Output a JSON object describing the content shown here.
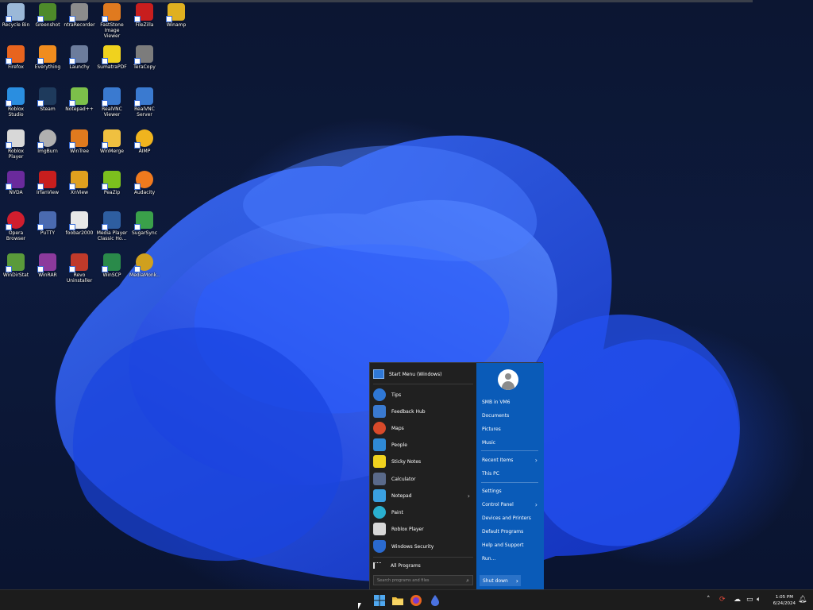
{
  "desktop": {
    "icons": [
      {
        "label": "Recycle Bin",
        "icon": "recycle-bin-icon",
        "color": "#9bb8d8"
      },
      {
        "label": "Greenshot",
        "icon": "greenshot-icon",
        "color": "#4e8a2a"
      },
      {
        "label": "ntraRecorder",
        "icon": "recorder-icon",
        "color": "#8c8c8c"
      },
      {
        "label": "FastStone Image Viewer",
        "icon": "faststone-icon",
        "color": "#e07a1f"
      },
      {
        "label": "FileZilla",
        "icon": "filezilla-icon",
        "color": "#c81e1e"
      },
      {
        "label": "Winamp",
        "icon": "winamp-icon",
        "color": "#e0b020"
      },
      {
        "label": "Firefox",
        "icon": "firefox-icon",
        "color": "#e8641e"
      },
      {
        "label": "Everything",
        "icon": "everything-icon",
        "color": "#f08c1e"
      },
      {
        "label": "Launchy",
        "icon": "launchy-icon",
        "color": "#6c7c9c"
      },
      {
        "label": "SumatraPDF",
        "icon": "sumatrapdf-icon",
        "color": "#f0d21e"
      },
      {
        "label": "TeraCopy",
        "icon": "teracopy-icon",
        "color": "#7c7c7c"
      },
      {
        "label": "Roblox Studio",
        "icon": "roblox-studio-icon",
        "color": "#2a8ee0"
      },
      {
        "label": "Steam",
        "icon": "steam-icon",
        "color": "#1e3a5c"
      },
      {
        "label": "Notepad++",
        "icon": "notepadpp-icon",
        "color": "#7cc04a"
      },
      {
        "label": "RealVNC Viewer",
        "icon": "realvnc-viewer-icon",
        "color": "#3a7ad0"
      },
      {
        "label": "RealVNC Server",
        "icon": "realvnc-server-icon",
        "color": "#3a7ad0"
      },
      {
        "label": "Roblox Player",
        "icon": "roblox-player-icon",
        "color": "#d8d8d8"
      },
      {
        "label": "ImgBurn",
        "icon": "imgburn-icon",
        "color": "#b0b0b0"
      },
      {
        "label": "WinTree",
        "icon": "wintree-icon",
        "color": "#e07a1e"
      },
      {
        "label": "WinMerge",
        "icon": "winmerge-icon",
        "color": "#f0c040"
      },
      {
        "label": "AIMP",
        "icon": "aimp-icon",
        "color": "#f0b41e"
      },
      {
        "label": "NVDA",
        "icon": "nvda-icon",
        "color": "#6a2a9c"
      },
      {
        "label": "IrfanView",
        "icon": "irfanview-icon",
        "color": "#c81e1e"
      },
      {
        "label": "XnView",
        "icon": "xnview-icon",
        "color": "#e0a01e"
      },
      {
        "label": "PeaZip",
        "icon": "peazip-icon",
        "color": "#7cc01e"
      },
      {
        "label": "Audacity",
        "icon": "audacity-icon",
        "color": "#f07a1e"
      },
      {
        "label": "Opera Browser",
        "icon": "opera-icon",
        "color": "#d01e2e"
      },
      {
        "label": "PuTTY",
        "icon": "putty-icon",
        "color": "#4a6ab0"
      },
      {
        "label": "foobar2000",
        "icon": "foobar-icon",
        "color": "#e8e8e8"
      },
      {
        "label": "Media Player Classic Ho...",
        "icon": "mpc-icon",
        "color": "#2e5ea0"
      },
      {
        "label": "SugarSync",
        "icon": "sugarsync-icon",
        "color": "#3aa04a"
      },
      {
        "label": "WinDirStat",
        "icon": "windirstat-icon",
        "color": "#5a9a3a"
      },
      {
        "label": "WinRAR",
        "icon": "winrar-icon",
        "color": "#8c3a9c"
      },
      {
        "label": "Revo Uninstaller",
        "icon": "revo-icon",
        "color": "#c03a2a"
      },
      {
        "label": "WinSCP",
        "icon": "winscp-icon",
        "color": "#2a8a4a"
      },
      {
        "label": "MediaMonk..",
        "icon": "mediamonkey-icon",
        "color": "#d0a01e"
      }
    ]
  },
  "start_menu": {
    "header_label": "Start Menu (Windows)",
    "items": [
      {
        "label": "Tips",
        "icon": "tips-icon",
        "color": "#2f78d6"
      },
      {
        "label": "Feedback Hub",
        "icon": "feedback-hub-icon",
        "color": "#3a7ad0"
      },
      {
        "label": "Maps",
        "icon": "maps-icon",
        "color": "#d84a2a"
      },
      {
        "label": "People",
        "icon": "people-icon",
        "color": "#2f8ad6"
      },
      {
        "label": "Sticky Notes",
        "icon": "sticky-notes-icon",
        "color": "#f0d21e"
      },
      {
        "label": "Calculator",
        "icon": "calculator-icon",
        "color": "#5a6a8a"
      },
      {
        "label": "Notepad",
        "icon": "notepad-icon",
        "color": "#3aa0e0",
        "submenu": true
      },
      {
        "label": "Paint",
        "icon": "paint-icon",
        "color": "#2ab0d0"
      },
      {
        "label": "Roblox Player",
        "icon": "roblox-icon",
        "color": "#d8d8d8"
      },
      {
        "label": "Windows Security",
        "icon": "shield-icon",
        "color": "#2a6ad0"
      }
    ],
    "all_programs_label": "All Programs",
    "search_placeholder": "Search programs and files",
    "right_items": [
      {
        "label": "SMB in VM6"
      },
      {
        "label": "Documents"
      },
      {
        "label": "Pictures"
      },
      {
        "label": "Music"
      },
      {
        "label": "Recent Items",
        "submenu": true
      },
      {
        "label": "This PC"
      },
      {
        "label": "Settings"
      },
      {
        "label": "Control Panel",
        "submenu": true
      },
      {
        "label": "Devices and Printers"
      },
      {
        "label": "Default Programs"
      },
      {
        "label": "Help and Support"
      },
      {
        "label": "Run..."
      }
    ],
    "shutdown_label": "Shut down",
    "colors": {
      "left_bg": "#202020",
      "right_bg": "#0a5bb8"
    }
  },
  "taskbar": {
    "buttons": [
      {
        "name": "start-button",
        "icon": "windows-logo-icon"
      },
      {
        "name": "file-explorer-button",
        "icon": "folder-icon"
      },
      {
        "name": "firefox-button",
        "icon": "firefox-icon"
      },
      {
        "name": "app-button",
        "icon": "app-icon"
      }
    ],
    "clock_time": "1:05 PM",
    "clock_date": "6/24/2024"
  }
}
